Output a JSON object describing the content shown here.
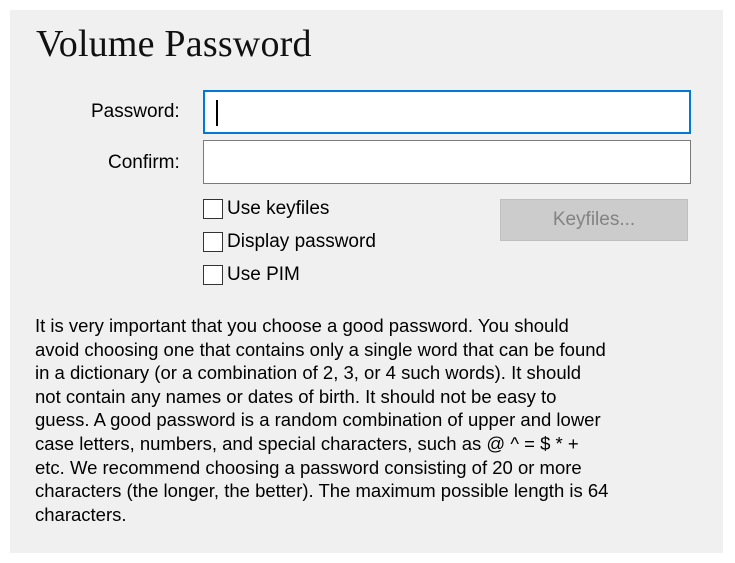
{
  "page": {
    "title": "Volume Password"
  },
  "password": {
    "label": "Password:",
    "value": ""
  },
  "confirm": {
    "label": "Confirm:",
    "value": ""
  },
  "options": [
    {
      "label": "Use keyfiles",
      "checked": false
    },
    {
      "label": "Display password",
      "checked": false
    },
    {
      "label": "Use PIM",
      "checked": false
    }
  ],
  "keyfiles_button": {
    "label": "Keyfiles...",
    "enabled": false
  },
  "description": [
    "It is very important that you choose a good password. You should",
    "avoid choosing one that contains only a single word that can be found",
    "in a dictionary (or a combination of 2, 3, or 4 such words). It should",
    "not contain any names or dates of birth. It should not be easy to",
    "guess. A good password is a random combination of upper and lower",
    "case letters, numbers, and special characters, such as @ ^ = $ * +",
    "etc. We recommend choosing a password consisting of 20 or more",
    "characters (the longer, the better). The maximum possible length is 64",
    "characters."
  ],
  "colors": {
    "panel_bg": "#f0f0f0",
    "focus_border": "#0078d7",
    "disabled_button_bg": "#cccccc",
    "disabled_button_text": "#838383"
  }
}
